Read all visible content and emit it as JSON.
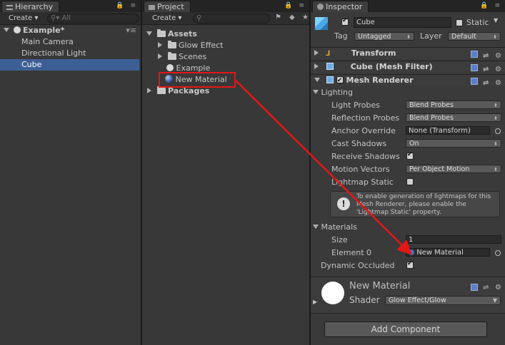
{
  "hierarchy": {
    "tab": "Hierarchy",
    "create": "Create ▾",
    "search_placeholder": "All",
    "scene": "Example*",
    "items": [
      "Main Camera",
      "Directional Light",
      "Cube"
    ],
    "selected": "Cube"
  },
  "project": {
    "tab": "Project",
    "create": "Create ▾",
    "assets": "Assets",
    "children": [
      "Glow Effect",
      "Scenes",
      "Example",
      "New Material"
    ],
    "packages": "Packages"
  },
  "inspector": {
    "tab": "Inspector",
    "object_name": "Cube",
    "static_label": "Static",
    "tag_label": "Tag",
    "tag_value": "Untagged",
    "layer_label": "Layer",
    "layer_value": "Default",
    "components": [
      "Transform",
      "Cube (Mesh Filter)",
      "Mesh Renderer"
    ],
    "lighting": {
      "section": "Lighting",
      "light_probes_label": "Light Probes",
      "light_probes_value": "Blend Probes",
      "reflection_probes_label": "Reflection Probes",
      "reflection_probes_value": "Blend Probes",
      "anchor_override_label": "Anchor Override",
      "anchor_override_value": "None (Transform)",
      "cast_shadows_label": "Cast Shadows",
      "cast_shadows_value": "On",
      "receive_shadows_label": "Receive Shadows",
      "motion_vectors_label": "Motion Vectors",
      "motion_vectors_value": "Per Object Motion",
      "lightmap_static_label": "Lightmap Static",
      "info_text": "To enable generation of lightmaps for this Mesh Renderer, please enable the 'Lightmap Static' property."
    },
    "materials": {
      "section": "Materials",
      "size_label": "Size",
      "size_value": "1",
      "element0_label": "Element 0",
      "element0_value": "New Material"
    },
    "dynamic_occluded_label": "Dynamic Occluded",
    "material_preview": {
      "name": "New Material",
      "shader_label": "Shader",
      "shader_value": "Glow Effect/Glow"
    },
    "add_component": "Add Component"
  },
  "colors": {
    "selection": "#3e5f96",
    "annotation": "#e51616"
  }
}
